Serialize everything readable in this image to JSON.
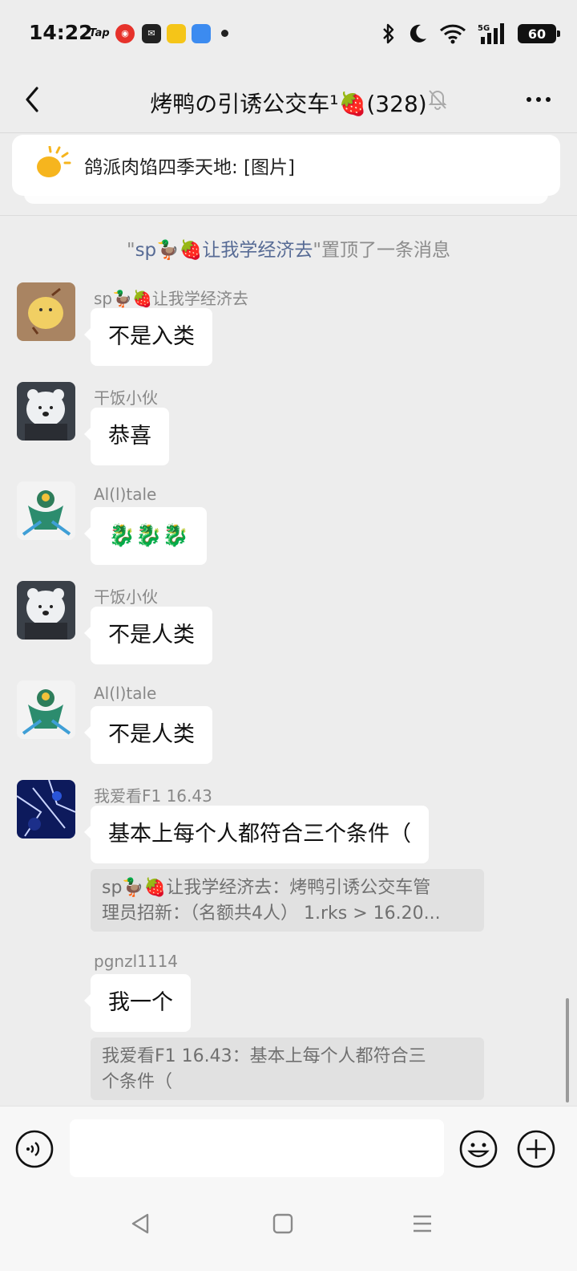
{
  "status_bar": {
    "time": "14:22",
    "apps": [
      "Tap",
      "netease-music-icon",
      "douban-icon",
      "notes-icon",
      "mail-icon"
    ],
    "battery": "60",
    "signal_label": "5G"
  },
  "header": {
    "title": "烤鸭の引诱公交车¹🍓(328)",
    "back_icon": "back-chevron-icon",
    "mute_icon": "bell-muted-icon",
    "more_icon": "more-icon"
  },
  "pinned": {
    "text": "鸽派肉馅四季天地: [图片]"
  },
  "system_notice": {
    "prefix": "\"",
    "name": "sp🦆🍓让我学经济去",
    "suffix": "\"置顶了一条消息"
  },
  "messages": [
    {
      "sender": "sp🦆🍓让我学经济去",
      "text": "不是入类"
    },
    {
      "sender": "干饭小伙",
      "text": "恭喜"
    },
    {
      "sender": "Al(l)tale",
      "text": "🐉🐉🐉"
    },
    {
      "sender": "干饭小伙",
      "text": "不是人类"
    },
    {
      "sender": "Al(l)tale",
      "text": "不是人类"
    },
    {
      "sender": "我爱看F1 16.43",
      "text": "基本上每个人都符合三个条件（",
      "quote_line1": "sp🦆🍓让我学经济去：烤鸭引诱公交车管",
      "quote_line2": "理员招新：（名额共4人） 1.rks > 16.20..."
    },
    {
      "sender": "pgnzl1114",
      "text": "我一个",
      "quote_line1": "我爱看F1 16.43：基本上每个人都符合三",
      "quote_line2": "个条件（"
    }
  ],
  "input_bar": {
    "voice_icon": "voice-icon",
    "emoji_icon": "emoji-icon",
    "plus_icon": "plus-icon",
    "placeholder": ""
  },
  "colors": {
    "background": "#ededed",
    "bubble": "#ffffff",
    "link": "#576b95",
    "quote_bg": "#e1e1e1"
  }
}
